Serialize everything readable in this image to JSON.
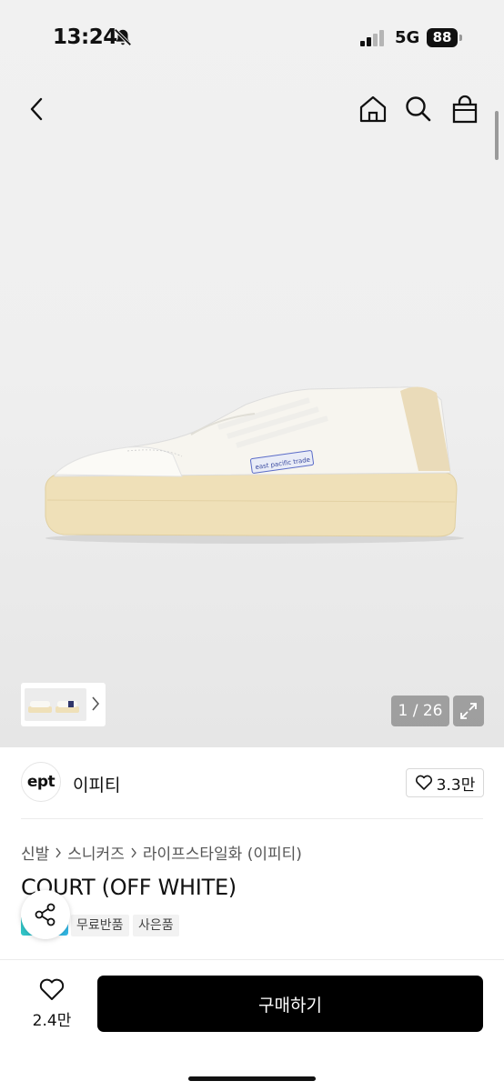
{
  "status_bar": {
    "time": "13:24",
    "network": "5G",
    "battery": "88",
    "icons": [
      "bell-slash-icon",
      "signal-icon"
    ]
  },
  "nav": {
    "icons": [
      "back-chevron-icon",
      "home-icon",
      "search-icon",
      "shopping-bag-icon"
    ]
  },
  "gallery": {
    "counter": "1 / 26",
    "product_label_text": "east pacific trade",
    "icons": [
      "chevron-right-icon",
      "expand-icon"
    ]
  },
  "brand": {
    "logo_text": "ept",
    "name": "이피티",
    "likes": "3.3만",
    "icons": [
      "heart-icon"
    ]
  },
  "breadcrumb": [
    "신발",
    "스니커즈",
    "라이프스타일화 (이피티)"
  ],
  "product": {
    "title": "COURT (OFF WHITE)",
    "tags": [
      "무료반품",
      "사은품"
    ]
  },
  "bottom_bar": {
    "wish_count": "2.4만",
    "buy_label": "구매하기",
    "icons": [
      "heart-outline-icon",
      "share-icon"
    ]
  },
  "colors": {
    "accent": "#000000",
    "badge": "#31c6c6",
    "sole": "#efe0b8",
    "heel": "#eadbb9",
    "label": "#5b6cc8"
  }
}
